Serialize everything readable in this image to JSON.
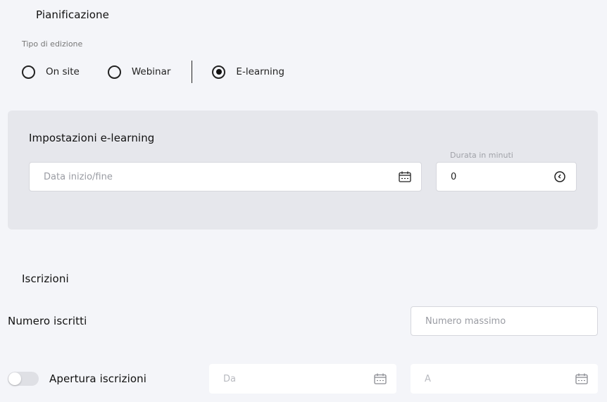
{
  "planning": {
    "title": "Pianificazione",
    "edition_type_label": "Tipo di edizione",
    "options": [
      {
        "label": "On site",
        "checked": false
      },
      {
        "label": "Webinar",
        "checked": false
      },
      {
        "label": "E-learning",
        "checked": true
      }
    ]
  },
  "elearning": {
    "title": "Impostazioni e-learning",
    "date_range_placeholder": "Data inizio/fine",
    "duration_label": "Durata in minuti",
    "duration_value": "0"
  },
  "subscriptions": {
    "title": "Iscrizioni",
    "count_label": "Numero iscritti",
    "max_placeholder": "Numero massimo",
    "opening_label": "Apertura iscrizioni",
    "opening_enabled": false,
    "from_placeholder": "Da",
    "to_placeholder": "A"
  },
  "icons": {
    "calendar": "calendar-icon",
    "clock": "clock-icon"
  }
}
